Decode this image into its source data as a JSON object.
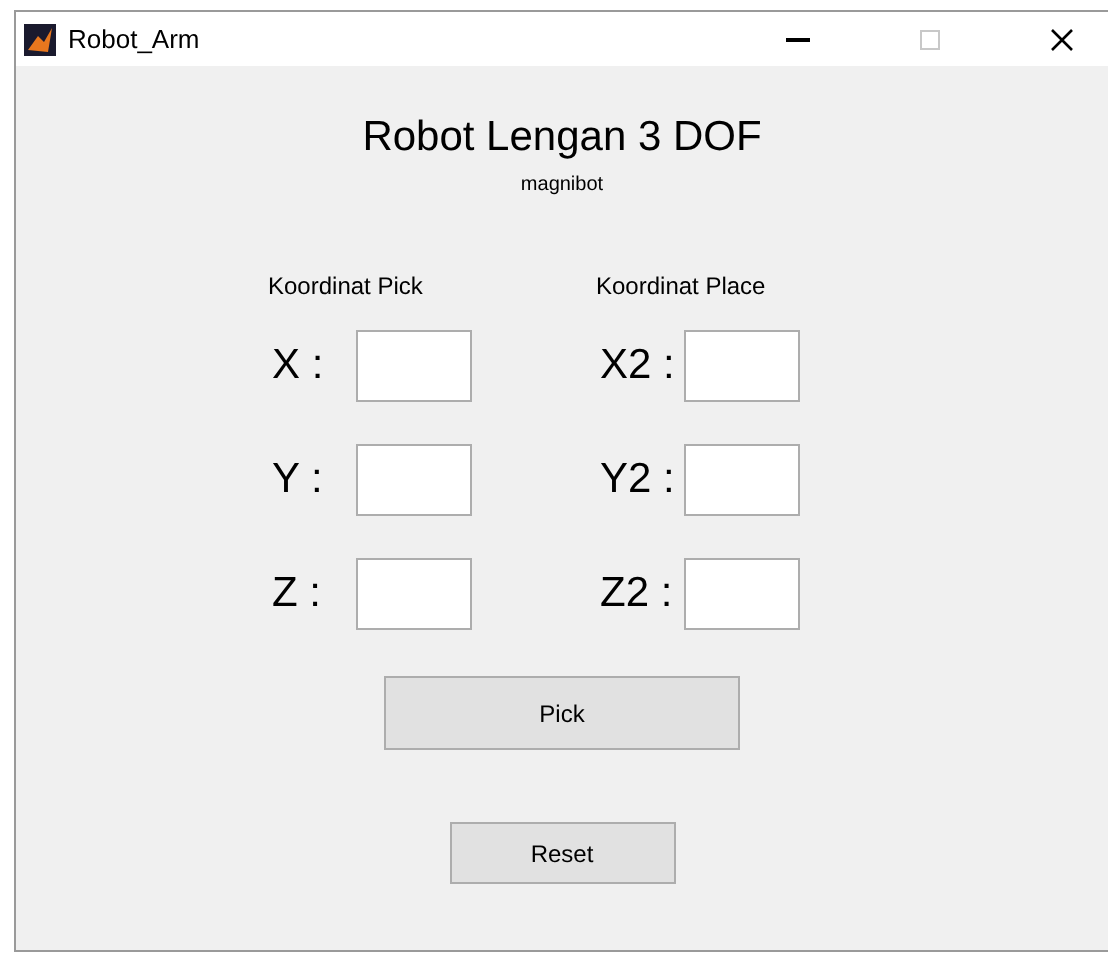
{
  "window": {
    "title": "Robot_Arm"
  },
  "heading": "Robot Lengan 3 DOF",
  "subtitle": "magnibot",
  "columns": [
    {
      "header": "Koordinat Pick",
      "fields": [
        {
          "label": "X :"
        },
        {
          "label": "Y :"
        },
        {
          "label": "Z :"
        }
      ]
    },
    {
      "header": "Koordinat Place",
      "fields": [
        {
          "label": "X2 :"
        },
        {
          "label": "Y2 :"
        },
        {
          "label": "Z2 :"
        }
      ]
    }
  ],
  "buttons": [
    {
      "label": "Pick",
      "kind": "wide"
    },
    {
      "label": "Reset",
      "kind": "narrow"
    }
  ]
}
